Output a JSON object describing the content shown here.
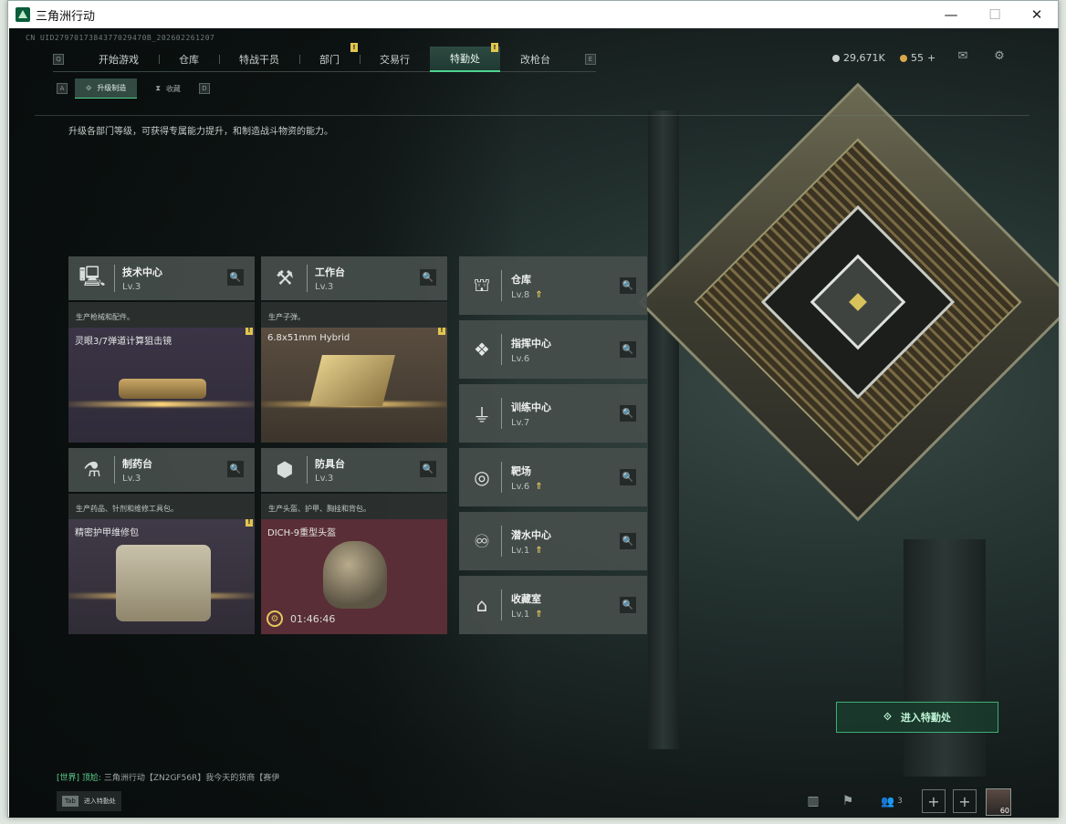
{
  "window": {
    "title": "三角洲行动",
    "minimize": "—",
    "maximize": "☐",
    "close": "✕"
  },
  "debug_id": "CN UID2797017384377029470B_202602261207",
  "nav": {
    "left_key": "Q",
    "right_key": "E",
    "tabs": [
      {
        "label": "开始游戏"
      },
      {
        "label": "仓库"
      },
      {
        "label": "特战干员"
      },
      {
        "label": "部门",
        "badge": "!"
      },
      {
        "label": "交易行"
      },
      {
        "label": "特勤处",
        "badge": "!",
        "active": true
      },
      {
        "label": "改枪台"
      }
    ]
  },
  "currency": {
    "coins": "29,671K",
    "tickets": "55",
    "plus": "+"
  },
  "subnav": {
    "left_key": "A",
    "right_key": "D",
    "tabs": [
      {
        "label": "升级制造",
        "active": true
      },
      {
        "label": "收藏"
      }
    ]
  },
  "description": "升级各部门等级，可获得专属能力提升，和制造战斗物资的能力。",
  "stations": [
    {
      "name": "技术中心",
      "level": "Lv.3",
      "sub": "生产枪械和配件。",
      "item": "灵眼3/7弹道计算狙击镜",
      "alert": "!",
      "body_color": "#3b3446"
    },
    {
      "name": "工作台",
      "level": "Lv.3",
      "sub": "生产子弹。",
      "item": "6.8x51mm Hybrid",
      "alert": "!",
      "body_color": "#4d4338"
    },
    {
      "name": "制药台",
      "level": "Lv.3",
      "sub": "生产药品、针剂和维修工具包。",
      "item": "精密护甲维修包",
      "alert": "!",
      "body_color": "#3a3644"
    },
    {
      "name": "防具台",
      "level": "Lv.3",
      "sub": "生产头盔、护甲、胸挂和背包。",
      "item": "DICH-9重型头盔",
      "timer": "01:46:46",
      "body_color": "#5a2e36"
    }
  ],
  "side_stations": [
    {
      "name": "仓库",
      "level": "Lv.8",
      "upgrade": "⇑"
    },
    {
      "name": "指挥中心",
      "level": "Lv.6",
      "upgrade": ""
    },
    {
      "name": "训练中心",
      "level": "Lv.7",
      "upgrade": ""
    },
    {
      "name": "靶场",
      "level": "Lv.6",
      "upgrade": "⇑"
    },
    {
      "name": "潜水中心",
      "level": "Lv.1",
      "upgrade": "⇑"
    },
    {
      "name": "收藏室",
      "level": "Lv.1",
      "upgrade": "⇑"
    }
  ],
  "enter_button": "进入特勤处",
  "chat": {
    "channel": "[世界]",
    "user": "顶尬:",
    "message": "三角洲行动【ZN2GF56R】我今天的货商【赛伊"
  },
  "tab_hint": {
    "key": "Tab",
    "label": "进入特勤处"
  },
  "bottom": {
    "friends_count": "3",
    "avatar_level": "60"
  },
  "colors": {
    "accent": "#4fd38f",
    "gold": "#e3c95b",
    "alert": "#e2c64f"
  }
}
